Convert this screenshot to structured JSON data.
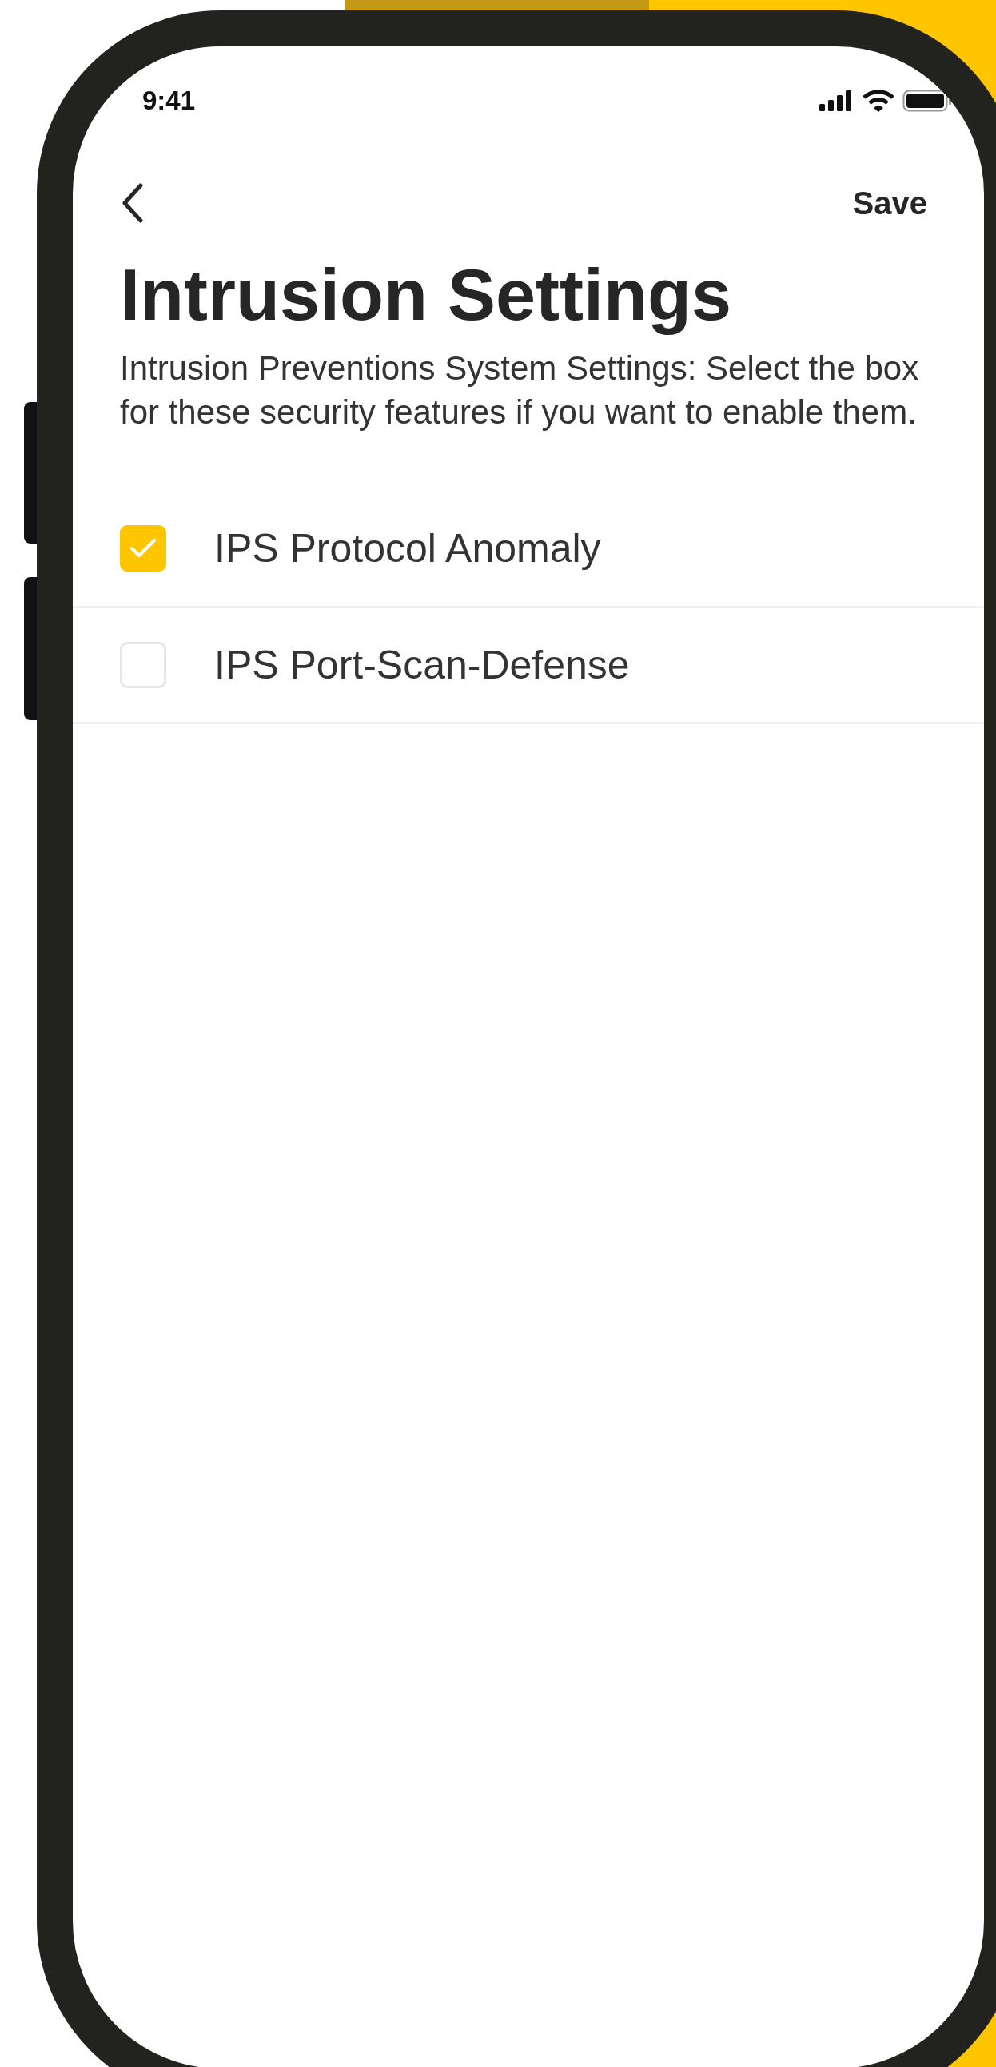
{
  "status_bar": {
    "time": "9:41"
  },
  "nav": {
    "action": "Save"
  },
  "title": "Intrusion Settings",
  "description": "Intrusion Preventions System Settings: Select the box for these security features if you want to enable them.",
  "options": [
    {
      "label": "IPS Protocol Anomaly",
      "checked": true
    },
    {
      "label": "IPS Port-Scan-Defense",
      "checked": false
    }
  ]
}
